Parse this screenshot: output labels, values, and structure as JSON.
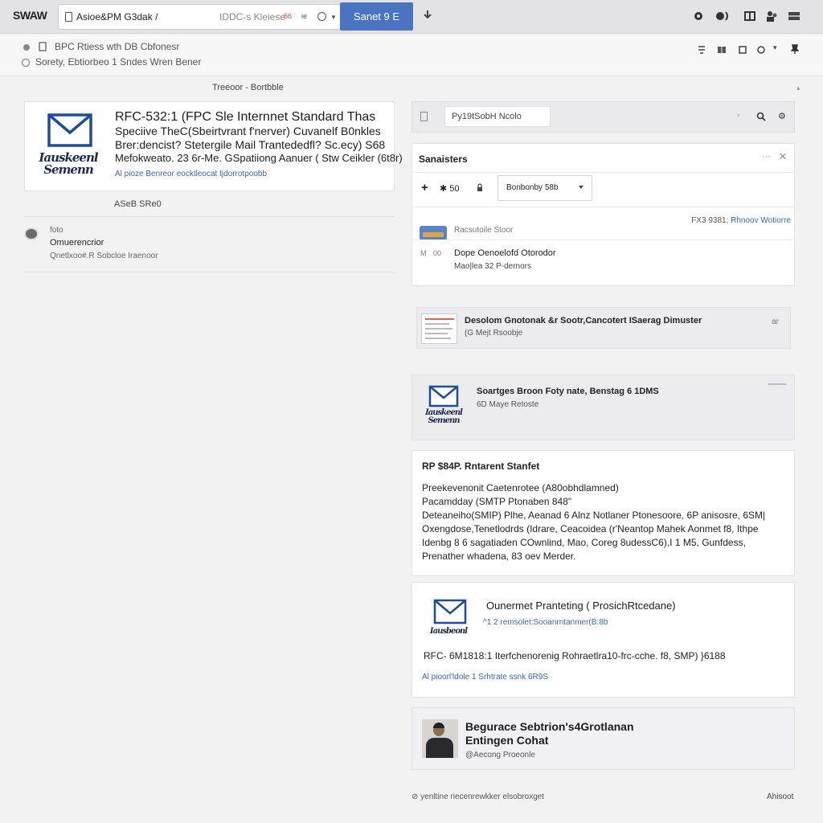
{
  "topbar": {
    "brand": "SWAW",
    "address": "Asioe&PM G3dak",
    "address_sep": "/",
    "address_extra": "IDDC-s Kleiese",
    "badge_1": "66",
    "badge_2": "ie",
    "search_button": "Sanet 9 E"
  },
  "subbar": {
    "line1": "BPC Rtiess wth DB Cbfonesr",
    "line2": "Sorety, Ebtiorbeo 1 Sndes Wren Bener"
  },
  "section_title": "Treeoor - Bortbble",
  "left_card": {
    "logo_text": "Iauskeenl Semenn",
    "title": "RFC-532:1 (FPC Sle Internnet Standard Thas",
    "line2": "Speciive TheC(Sbeirtvrant f'nerver) Cuvanelf B0nkles",
    "line3": "Brer:dencist? Stetergile Mail Trantededfl? Sc.ecy) S68",
    "line4": "Mefokweato. 23 6r-Me. GSpatiiong Aanuer ( Stw Ceikler (6t8r)",
    "link": "Al pioze Benreor eocktleocat tjdorrotpoobb"
  },
  "asf_label": "ASeB SRe0",
  "left_row": {
    "line1": "foto",
    "line2": "Omuerencrior",
    "line3": "Qnetlxoo#.R Sobcloe Iraenoor"
  },
  "right_search": {
    "value": "Py19tSobH Ncolo"
  },
  "panel": {
    "title": "Sanaisters",
    "control_label": "50",
    "select_value": "Bonbonby 58b",
    "row1_label": "Racsutoile Stoor",
    "row1_right_prefix": "FX3 9381;",
    "row1_right_link": "Rhnoov Wotiorre",
    "row2_n1": "M",
    "row2_n2": "00",
    "row2_title": "Dope Oenoelofd Otorodor",
    "row2_sub": "Mao|lea 32 P-dernors"
  },
  "card2": {
    "title": "Desolom Gnotonak &r Sootr,Cancotert ISaerag Dimuster",
    "sub": "(G Mejt Rsoobje",
    "side": "ar"
  },
  "card3": {
    "logo_text": "Iauskeenl Semenn",
    "title": "Soartges Broon Foty nate, Benstag 6 1DMS",
    "sub": "6D Maye Retoste"
  },
  "card4": {
    "title": "RP $84P. Rntarent Stanfet",
    "lines": [
      "Preekevenonit Caetenrotee (A80obhdlamned)",
      "Pacamdday (SMTP Ptonaben 848\"",
      "Deteaneiho(SMIP) Plhe, Aeanad 6 Alnz Notlaner Ptonesoore, 6P anisosre, 6SM|",
      "Oxengdose,Tenetlodrds (Idrare, Ceacoidea (r'Neantop Mahek Aonmet f8, Ithpe",
      "Idenbg 8 6 sagatiaden COwnlind, Mao, Coreg 8udessC6),I 1 M5, Gunfdess,",
      "Prenather whadena, 83 oev Merder."
    ]
  },
  "card5": {
    "logo_text": "Iausbeonl",
    "title": "Ounermet Pranteting ( ProsichRtcedane)",
    "sub": "^1 2 remsolet:Sooanrntanmer(B:8b",
    "body": "RFC- 6M1818:1 Iterfchenorenig Rohraetlra10-frc-cche. f8, SMP) }6188",
    "link": "Al pioorl'ldole 1 Srhtrate ssnk 6R9S"
  },
  "card6": {
    "title1": "Begurace Sebtrion's4Grotlanan",
    "title2": "Entingen Cohat",
    "sub": "@Aecong Proeonle"
  },
  "footer": {
    "left": "yenltine riecenrewkker elsobroxget",
    "right": "Ahisoot"
  },
  "colors": {
    "accent": "#4a74c2",
    "link": "#3b66b8",
    "envelope": "#1f4b9c",
    "background": "#f2f2f3"
  },
  "icons": [
    "document-icon",
    "download-icon",
    "record-icon",
    "sound-icon",
    "grid-icon",
    "user-icon",
    "menu-icon",
    "envelope-icon",
    "search-icon",
    "gear-icon",
    "close-icon",
    "plus-icon",
    "lock-icon",
    "chevron-down-icon"
  ]
}
